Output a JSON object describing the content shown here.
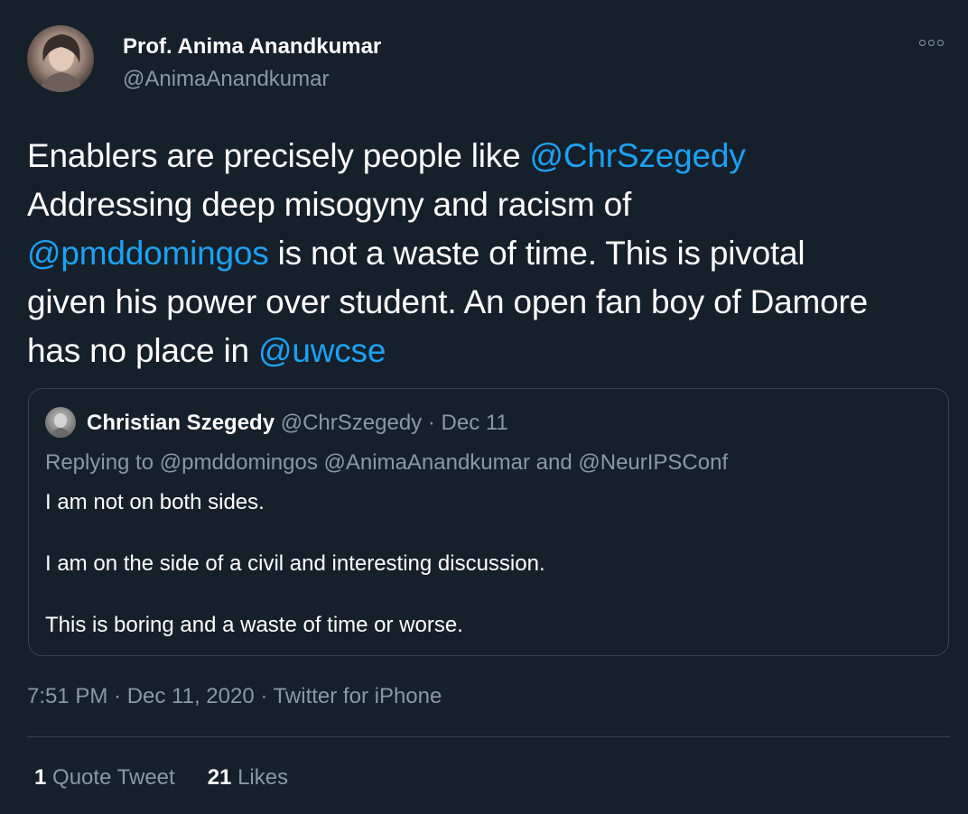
{
  "author": {
    "name": "Prof. Anima Anandkumar",
    "handle": "@AnimaAnandkumar",
    "avatar_icon": "profile-photo"
  },
  "more_icon": "more-options-icon",
  "tweet": {
    "lines": [
      {
        "text": "Enablers are precisely people like ",
        "mention": "@ChrSzegedy",
        "after": ""
      },
      {
        "text": "Addressing deep misogyny and racism of",
        "mention": "",
        "after": ""
      },
      {
        "text": "",
        "mention": "@pmddomingos",
        "after": " is not a waste of time. This is pivotal"
      },
      {
        "text": "given his power over student. An open fan boy of Damore",
        "mention": "",
        "after": ""
      },
      {
        "text": "has no place in ",
        "mention": "@uwcse",
        "after": ""
      }
    ]
  },
  "quoted": {
    "name": "Christian Szegedy",
    "handle": "@ChrSzegedy",
    "separator": "·",
    "date": "Dec 11",
    "replying_to": "Replying to @pmddomingos @AnimaAnandkumar and @NeurIPSConf",
    "lines": [
      "I am not on both sides.",
      "I am on the side of a civil and interesting discussion.",
      "This is boring and a waste of time or worse."
    ]
  },
  "timestamp": "7:51 PM · Dec 11, 2020 · Twitter for iPhone",
  "stats": {
    "quote_count": "1",
    "quote_label": "Quote Tweet",
    "likes_count": "21",
    "likes_label": "Likes"
  },
  "colors": {
    "background": "#15202b",
    "mention": "#1da1f2",
    "secondary_text": "#8899a6",
    "border": "#38444d"
  }
}
